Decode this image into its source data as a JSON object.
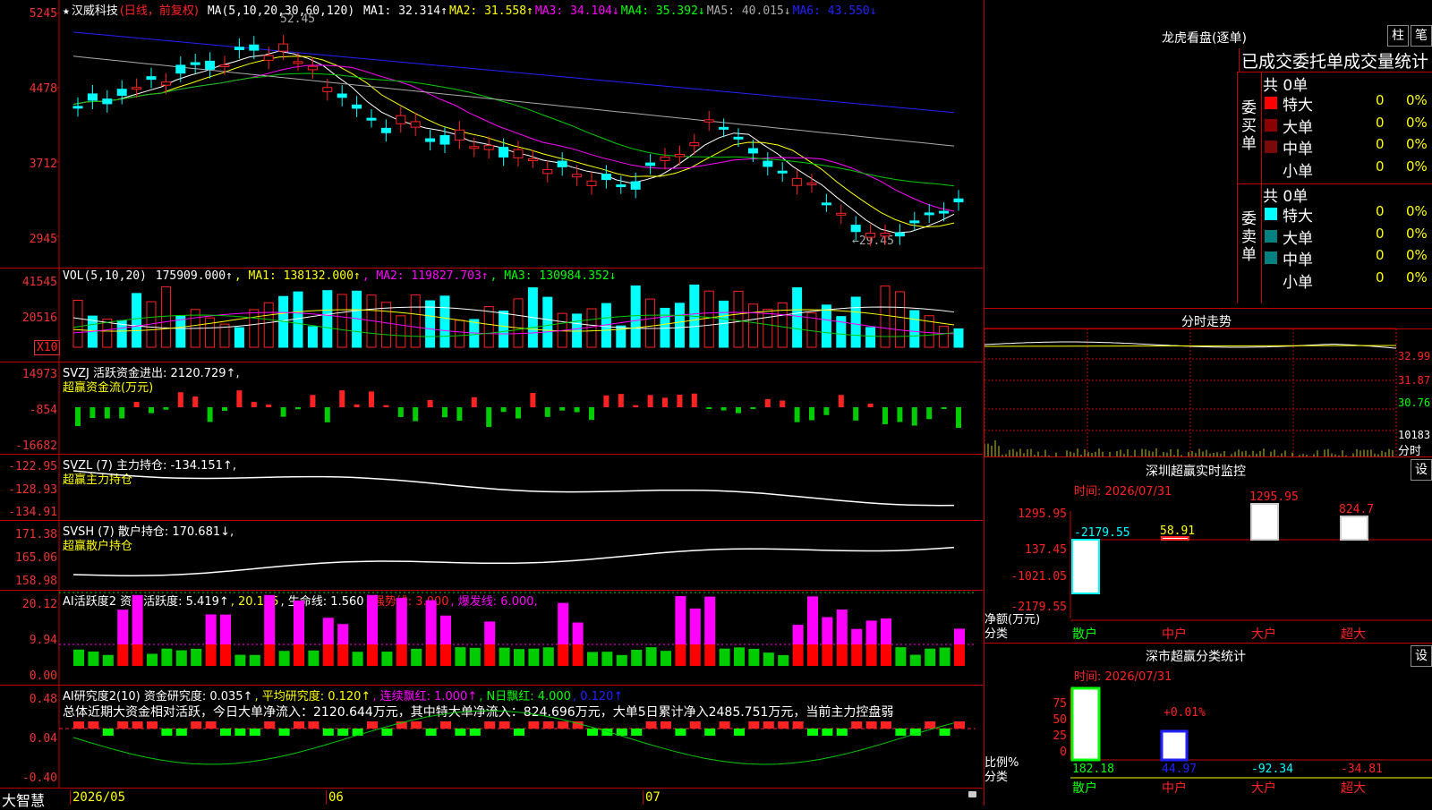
{
  "app_name": "大智慧",
  "kline": {
    "stock": "汉威科技",
    "period_label": "(日线，前复权)",
    "ma_label": "MA(5,10,20,30,60,120)",
    "ma1": "MA1: 32.314↑",
    "ma2": "MA2: 31.558↑",
    "ma3": "MA3: 34.104↓",
    "ma4": "MA4: 35.392↓",
    "ma5": "MA5: 40.015↓",
    "ma6": "MA6: 43.550↓",
    "y_labels": [
      "5245",
      "4478",
      "3712",
      "2945"
    ],
    "high_mark": "52.45",
    "low_mark": "←29.45"
  },
  "vol": {
    "label": "VOL(5,10,20)",
    "value": "175909.000↑",
    "ma1": ", MA1: 138132.000↑",
    "ma2": ", MA2: 119827.703↑",
    "ma3": ", MA3: 130984.352↓",
    "y_labels": [
      "41545",
      "20516"
    ],
    "unit": "X10"
  },
  "svzj": {
    "label": "SVZJ  活跃资金进出: 2120.729↑,",
    "sub": "超赢资金流(万元)",
    "y_labels": [
      "14973",
      "-854",
      "-16682"
    ]
  },
  "svzl": {
    "label": "SVZL (7) 主力持仓: -134.151↑,",
    "sub": "超赢主力持仓",
    "y_labels": [
      "-122.95",
      "-128.93",
      "-134.91"
    ]
  },
  "svsh": {
    "label": "SVSH (7) 散户持仓: 170.681↓,",
    "sub": "超赢散户持仓",
    "y_labels": [
      "171.38",
      "165.06",
      "158.98"
    ]
  },
  "ai1": {
    "label": "AI活跃度2 资金活跃度: 5.419↑",
    "v2": ", 20.125",
    "life": ", 生命线: 1.560",
    "strong": ", 强势线: 3.000",
    "burst": ", 爆发线: 6.000,",
    "y_labels": [
      "20.12",
      "9.94",
      "0.00"
    ]
  },
  "ai2": {
    "label": "AI研究度2(10) 资金研究度: 0.035↑",
    "avg": ", 平均研究度: 0.120↑",
    "cont": ", 连续飘红: 1.000↑",
    "nday": ", N日飘红: 4.000",
    "tail": ", 0.120↑",
    "summary": "总体近期大资金相对活跃，今日大单净流入：2120.644万元，其中特大单净流入：824.696万元，大单5日累计净入2485.751万元，当前主力控盘弱",
    "y_labels": [
      "0.48",
      "0.04",
      "-0.40"
    ]
  },
  "x_axis": [
    "2026/05",
    "06",
    "07"
  ],
  "dragon": {
    "title": "龙虎看盘(逐单)",
    "btn1": "柱",
    "btn2": "笔",
    "tabs": "已成交委托单成交量统计",
    "buy_total": "共 0单",
    "buy_side": "委买单",
    "sell_total": "共 0单",
    "sell_side": "委卖单",
    "rows": [
      {
        "label": "特大",
        "count": "0",
        "pct": "0%"
      },
      {
        "label": "大单",
        "count": "0",
        "pct": "0%"
      },
      {
        "label": "中单",
        "count": "0",
        "pct": "0%"
      },
      {
        "label": "小单",
        "count": "0",
        "pct": "0%"
      }
    ],
    "colors_buy": [
      "#ff0000",
      "#8b0000",
      "#7a0a0a",
      "#000000"
    ],
    "colors_sell": [
      "#00ffff",
      "#008080",
      "#008080",
      "#000000"
    ]
  },
  "intraday": {
    "title": "分时走势",
    "y_labels": [
      "32.99",
      "31.87",
      "30.76",
      "10183",
      "分时"
    ]
  },
  "sz_monitor": {
    "title": "深圳超赢实时监控",
    "btn": "设",
    "time": "时间: 2026/07/31",
    "y_labels": [
      "1295.95",
      "137.45",
      "-1021.05",
      "-2179.55"
    ],
    "net_label": "净额(万元)",
    "cat_label": "分类",
    "values": [
      "-2179.55",
      "58.91",
      "1295.95",
      "824.7"
    ],
    "cats": [
      "散户",
      "中户",
      "大户",
      "超大"
    ]
  },
  "sz_class": {
    "title": "深市超赢分类统计",
    "btn": "设",
    "time": "时间: 2026/07/31",
    "y_labels": [
      "75",
      "50",
      "25",
      "0"
    ],
    "pct_mark": "+0.01%",
    "ratio_label": "比例%",
    "cat_label": "分类",
    "values": [
      "182.18",
      "44.97",
      "-92.34",
      "-34.81"
    ],
    "cats": [
      "散户",
      "中户",
      "大户",
      "超大"
    ]
  }
}
